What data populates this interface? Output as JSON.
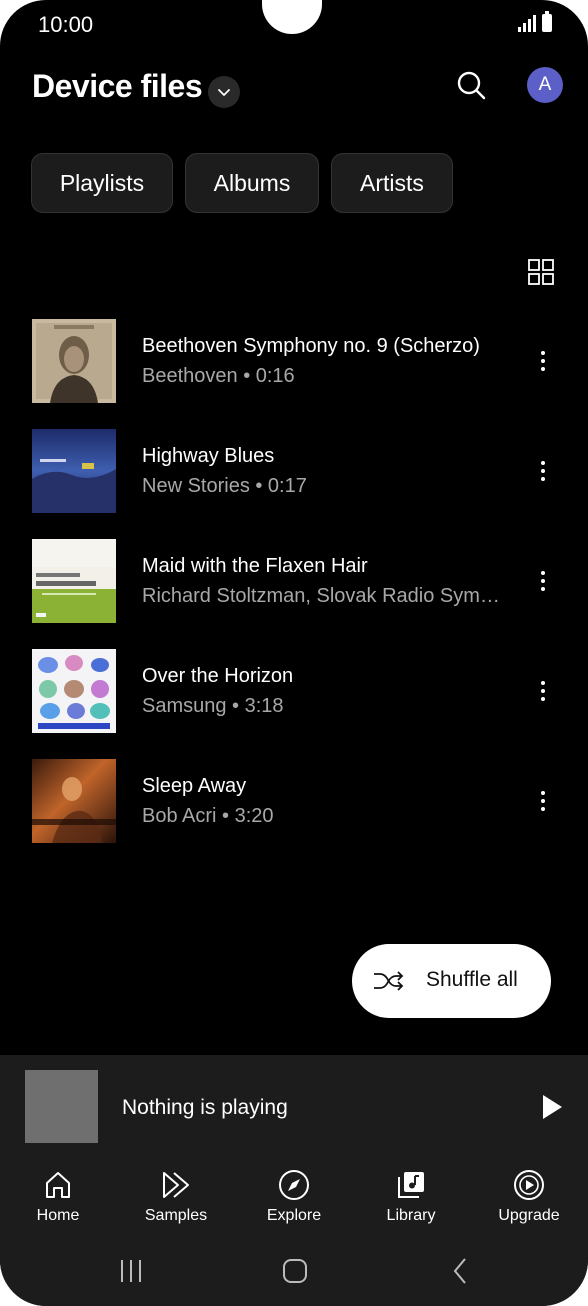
{
  "status_bar": {
    "time": "10:00"
  },
  "header": {
    "title": "Device files",
    "avatar_letter": "A"
  },
  "chips": [
    {
      "label": "Playlists"
    },
    {
      "label": "Albums"
    },
    {
      "label": "Artists"
    }
  ],
  "songs": [
    {
      "title": "Beethoven Symphony no. 9 (Scherzo)",
      "subtitle": "Beethoven • 0:16"
    },
    {
      "title": "Highway Blues",
      "subtitle": "New Stories • 0:17"
    },
    {
      "title": "Maid with the Flaxen Hair",
      "subtitle": "Richard Stoltzman, Slovak Radio Sym…"
    },
    {
      "title": "Over the Horizon",
      "subtitle": "Samsung • 3:18"
    },
    {
      "title": "Sleep Away",
      "subtitle": "Bob Acri • 3:20"
    }
  ],
  "shuffle_button": {
    "label": "Shuffle all"
  },
  "now_playing": {
    "text": "Nothing is playing"
  },
  "bottom_nav": [
    {
      "label": "Home",
      "icon": "home-icon"
    },
    {
      "label": "Samples",
      "icon": "samples-icon"
    },
    {
      "label": "Explore",
      "icon": "compass-icon"
    },
    {
      "label": "Library",
      "icon": "library-icon"
    },
    {
      "label": "Upgrade",
      "icon": "upgrade-icon"
    }
  ],
  "colors": {
    "background": "#000000",
    "surface": "#1c1c1c",
    "avatar": "#5b5fc7",
    "subtext": "#a8a8a8"
  }
}
